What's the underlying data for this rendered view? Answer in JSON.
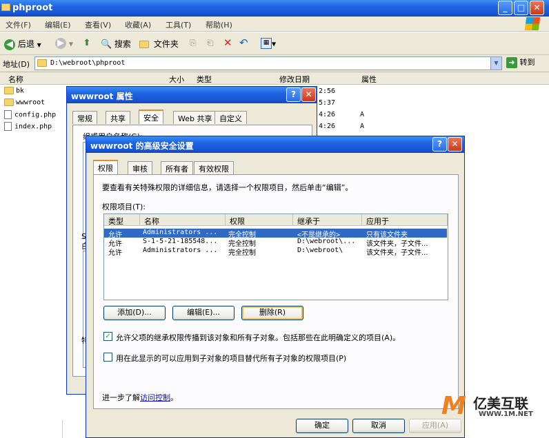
{
  "window": {
    "title": "phproot",
    "controls": {
      "minimize": "_",
      "maximize": "□",
      "close": "✕"
    }
  },
  "menu": [
    "文件(F)",
    "编辑(E)",
    "查看(V)",
    "收藏(A)",
    "工具(T)",
    "帮助(H)"
  ],
  "toolbar": {
    "back": "后退",
    "search": "搜索",
    "folders": "文件夹"
  },
  "address": {
    "label": "地址(D)",
    "value": "D:\\webroot\\phproot",
    "go": "转到"
  },
  "columns": {
    "name": "名称",
    "size": "大小",
    "type": "类型",
    "modified": "修改日期",
    "attr": "属性"
  },
  "files": [
    {
      "name": "bk",
      "kind": "folder",
      "time": "2:56",
      "attr": ""
    },
    {
      "name": "wwwroot",
      "kind": "folder",
      "time": "5:37",
      "attr": ""
    },
    {
      "name": "config.php",
      "kind": "file",
      "time": "4:26",
      "attr": "A"
    },
    {
      "name": "index.php",
      "kind": "file",
      "time": "4:26",
      "attr": "A"
    }
  ],
  "props": {
    "title": "wwwroot 属性",
    "tabs": [
      "常规",
      "共享",
      "安全",
      "Web 共享",
      "自定义"
    ],
    "group_label": "组或用户名称(G):",
    "partial_s": "S",
    "partial_e": "白",
    "partial_t": "特"
  },
  "adv": {
    "title": "wwwroot 的高级安全设置",
    "tabs": [
      "权限",
      "审核",
      "所有者",
      "有效权限"
    ],
    "info": "要查看有关特殊权限的详细信息，请选择一个权限项目，然后单击“编辑”。",
    "list_label": "权限项目(T):",
    "list_headers": [
      "类型",
      "名称",
      "权限",
      "继承于",
      "应用于"
    ],
    "rows": [
      [
        "允许",
        "Administrators ...",
        "完全控制",
        "<不是继承的>",
        "只有该文件夹"
      ],
      [
        "允许",
        "S-1-5-21-185548...",
        "完全控制",
        "D:\\webroot\\...",
        "该文件夹，子文件..."
      ],
      [
        "允许",
        "Administrators ...",
        "完全控制",
        "D:\\webroot\\",
        "该文件夹，子文件..."
      ]
    ],
    "buttons": {
      "add": "添加(D)...",
      "edit": "编辑(E)...",
      "remove": "删除(R)"
    },
    "check1": "允许父项的继承权限传播到该对象和所有子对象。包括那些在此明确定义的项目(A)。",
    "check2": "用在此显示的可以应用到子对象的项目替代所有子对象的权限项目(P)",
    "more_prefix": "进一步了解",
    "more_link": "访问控制",
    "more_suffix": "。",
    "ok": "确定",
    "cancel": "取消",
    "apply": "应用(A)"
  },
  "watermark": {
    "text": "亿美互联",
    "url": "WWW.1M.NET"
  }
}
